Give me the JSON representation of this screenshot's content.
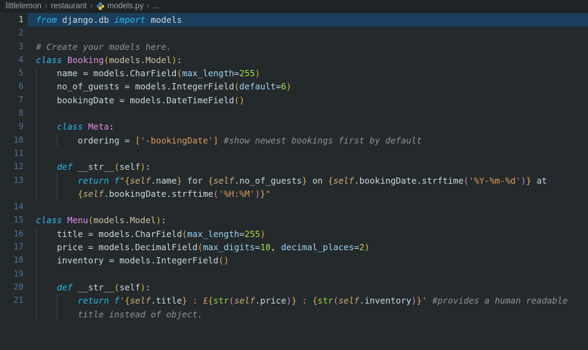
{
  "breadcrumb": {
    "separator": "›",
    "items": [
      "littlelemon",
      "restaurant",
      "models.py",
      "..."
    ],
    "file_icon": "python-icon"
  },
  "colors": {
    "editor_background": "#24292c",
    "breadcrumb_background": "#1e2326",
    "selected_line_highlight": "#1a3e5e",
    "keyword": "#30b7e8",
    "class_name": "#e08fe0",
    "string": "#d99a5b",
    "number": "#a2e244",
    "comment": "#8b9399",
    "default_text": "#ccd8de",
    "parameter": "#9cd4f0",
    "bracket_gold": "#d9b44a",
    "bracket_pink": "#d883c8",
    "line_number": "#4d7394",
    "python_logo_blue": "#4b8bbe",
    "python_logo_yellow": "#ffd43b"
  },
  "editor": {
    "lines": [
      {
        "n": "1",
        "sel": true,
        "g": [],
        "t": [
          [
            "k",
            "from"
          ],
          [
            "t",
            " django.db "
          ],
          [
            "k",
            "import"
          ],
          [
            "t",
            " models"
          ]
        ]
      },
      {
        "n": "2",
        "g": [],
        "t": []
      },
      {
        "n": "3",
        "g": [],
        "t": [
          [
            "m",
            "# Create your models here."
          ]
        ]
      },
      {
        "n": "4",
        "g": [],
        "t": [
          [
            "k",
            "class"
          ],
          [
            "t",
            " "
          ],
          [
            "c",
            "Booking"
          ],
          [
            "b1",
            "("
          ],
          [
            "a",
            "models.Model"
          ],
          [
            "b1",
            ")"
          ],
          [
            "t",
            ":"
          ]
        ]
      },
      {
        "n": "5",
        "g": [
          0
        ],
        "t": [
          [
            "t",
            "    name = models.CharField"
          ],
          [
            "b1",
            "("
          ],
          [
            "p",
            "max_length"
          ],
          [
            "t",
            "="
          ],
          [
            "n",
            "255"
          ],
          [
            "b1",
            ")"
          ]
        ]
      },
      {
        "n": "6",
        "g": [
          0
        ],
        "t": [
          [
            "t",
            "    no_of_guests = models.IntegerField"
          ],
          [
            "b1",
            "("
          ],
          [
            "p",
            "default"
          ],
          [
            "t",
            "="
          ],
          [
            "n",
            "6"
          ],
          [
            "b1",
            ")"
          ]
        ]
      },
      {
        "n": "7",
        "g": [
          0
        ],
        "t": [
          [
            "t",
            "    bookingDate = models.DateTimeField"
          ],
          [
            "b1",
            "()"
          ]
        ]
      },
      {
        "n": "8",
        "g": [
          0
        ],
        "t": []
      },
      {
        "n": "9",
        "g": [
          0
        ],
        "t": [
          [
            "t",
            "    "
          ],
          [
            "k",
            "class"
          ],
          [
            "t",
            " "
          ],
          [
            "c",
            "Meta"
          ],
          [
            "t",
            ":"
          ]
        ]
      },
      {
        "n": "10",
        "g": [
          0,
          1
        ],
        "t": [
          [
            "t",
            "        ordering = "
          ],
          [
            "b1",
            "["
          ],
          [
            "s",
            "'-bookingDate'"
          ],
          [
            "b1",
            "]"
          ],
          [
            "t",
            " "
          ],
          [
            "m",
            "#show newest bookings first by default"
          ]
        ]
      },
      {
        "n": "11",
        "g": [
          0
        ],
        "t": []
      },
      {
        "n": "12",
        "g": [
          0
        ],
        "t": [
          [
            "t",
            "    "
          ],
          [
            "k",
            "def"
          ],
          [
            "t",
            " __str__"
          ],
          [
            "b1",
            "("
          ],
          [
            "t",
            "self"
          ],
          [
            "b1",
            ")"
          ],
          [
            "t",
            ":"
          ]
        ]
      },
      {
        "n": "13",
        "g": [
          0,
          1
        ],
        "t": [
          [
            "t",
            "        "
          ],
          [
            "k",
            "return"
          ],
          [
            "t",
            " "
          ],
          [
            "k",
            "f"
          ],
          [
            "s",
            "\""
          ],
          [
            "b1",
            "{"
          ],
          [
            "sf",
            "self"
          ],
          [
            "t",
            ".name"
          ],
          [
            "b1",
            "}"
          ],
          [
            "l",
            " for "
          ],
          [
            "b1",
            "{"
          ],
          [
            "sf",
            "self"
          ],
          [
            "t",
            ".no_of_guests"
          ],
          [
            "b1",
            "}"
          ],
          [
            "l",
            " on "
          ],
          [
            "b1",
            "{"
          ],
          [
            "sf",
            "self"
          ],
          [
            "t",
            ".bookingDate.strftime"
          ],
          [
            "b2",
            "("
          ],
          [
            "s",
            "'%Y-%m-%d'"
          ],
          [
            "b2",
            ")"
          ],
          [
            "b1",
            "}"
          ],
          [
            "l",
            " at"
          ]
        ]
      },
      {
        "n": "",
        "wrap": true,
        "g": [
          0,
          1
        ],
        "t": [
          [
            "t",
            "        "
          ],
          [
            "b1",
            "{"
          ],
          [
            "sf",
            "self"
          ],
          [
            "t",
            ".bookingDate.strftime"
          ],
          [
            "b2",
            "("
          ],
          [
            "s",
            "'%H:%M'"
          ],
          [
            "b2",
            ")"
          ],
          [
            "b1",
            "}"
          ],
          [
            "s",
            "\""
          ]
        ]
      },
      {
        "n": "14",
        "g": [],
        "t": []
      },
      {
        "n": "15",
        "g": [],
        "t": [
          [
            "k",
            "class"
          ],
          [
            "t",
            " "
          ],
          [
            "c",
            "Menu"
          ],
          [
            "b1",
            "("
          ],
          [
            "a",
            "models.Model"
          ],
          [
            "b1",
            ")"
          ],
          [
            "t",
            ":"
          ]
        ]
      },
      {
        "n": "16",
        "g": [
          0
        ],
        "t": [
          [
            "t",
            "    title = models.CharField"
          ],
          [
            "b1",
            "("
          ],
          [
            "p",
            "max_length"
          ],
          [
            "t",
            "="
          ],
          [
            "n",
            "255"
          ],
          [
            "b1",
            ")"
          ]
        ]
      },
      {
        "n": "17",
        "g": [
          0
        ],
        "t": [
          [
            "t",
            "    price = models.DecimalField"
          ],
          [
            "b1",
            "("
          ],
          [
            "p",
            "max_digits"
          ],
          [
            "t",
            "="
          ],
          [
            "n",
            "10"
          ],
          [
            "t",
            ", "
          ],
          [
            "p",
            "decimal_places"
          ],
          [
            "t",
            "="
          ],
          [
            "n",
            "2"
          ],
          [
            "b1",
            ")"
          ]
        ]
      },
      {
        "n": "18",
        "g": [
          0
        ],
        "t": [
          [
            "t",
            "    inventory = models.IntegerField"
          ],
          [
            "b1",
            "()"
          ]
        ]
      },
      {
        "n": "19",
        "g": [
          0
        ],
        "t": []
      },
      {
        "n": "20",
        "g": [
          0
        ],
        "t": [
          [
            "t",
            "    "
          ],
          [
            "k",
            "def"
          ],
          [
            "t",
            " __str__"
          ],
          [
            "b1",
            "("
          ],
          [
            "t",
            "self"
          ],
          [
            "b1",
            ")"
          ],
          [
            "t",
            ":"
          ]
        ]
      },
      {
        "n": "21",
        "g": [
          0,
          1
        ],
        "t": [
          [
            "t",
            "        "
          ],
          [
            "k",
            "return"
          ],
          [
            "t",
            " "
          ],
          [
            "k",
            "f"
          ],
          [
            "s",
            "'"
          ],
          [
            "b1",
            "{"
          ],
          [
            "sf",
            "self"
          ],
          [
            "t",
            ".title"
          ],
          [
            "b1",
            "}"
          ],
          [
            "s",
            " : £"
          ],
          [
            "b1",
            "{"
          ],
          [
            "bi",
            "str"
          ],
          [
            "b2",
            "("
          ],
          [
            "sf",
            "self"
          ],
          [
            "t",
            ".price"
          ],
          [
            "b2",
            ")"
          ],
          [
            "b1",
            "}"
          ],
          [
            "s",
            " : "
          ],
          [
            "b1",
            "{"
          ],
          [
            "bi",
            "str"
          ],
          [
            "b2",
            "("
          ],
          [
            "sf",
            "self"
          ],
          [
            "t",
            ".inventory"
          ],
          [
            "b2",
            ")"
          ],
          [
            "b1",
            "}"
          ],
          [
            "s",
            "'"
          ],
          [
            "t",
            " "
          ],
          [
            "m",
            "#provides a human readable"
          ]
        ]
      },
      {
        "n": "",
        "wrap": true,
        "g": [
          0,
          1
        ],
        "t": [
          [
            "t",
            "        "
          ],
          [
            "m",
            "title instead of object."
          ]
        ]
      }
    ]
  }
}
